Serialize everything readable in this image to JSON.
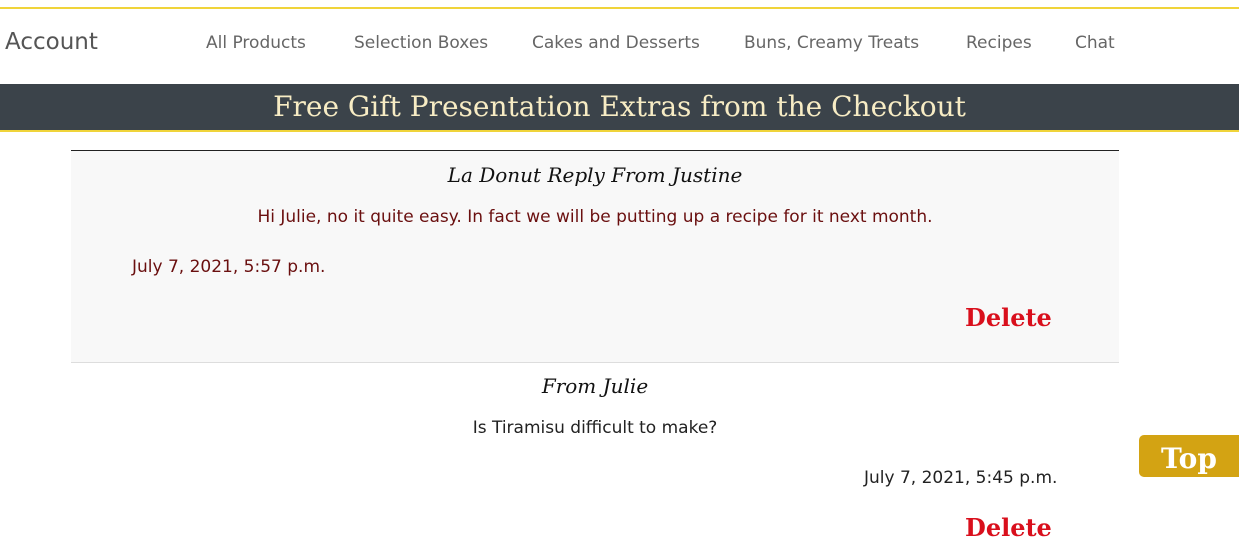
{
  "nav": {
    "account": "Account",
    "links": [
      "All Products",
      "Selection Boxes",
      "Cakes and Desserts",
      "Buns, Creamy Treats",
      "Recipes",
      "Chat"
    ]
  },
  "banner": {
    "text": "Free Gift Presentation Extras from the Checkout"
  },
  "messages": [
    {
      "heading": "La Donut Reply From Justine",
      "body": "Hi Julie, no it quite easy. In fact we will be putting up a recipe for it next month.",
      "date": "July 7, 2021, 5:57 p.m.",
      "delete_label": "Delete"
    },
    {
      "heading": "From Julie",
      "body": "Is Tiramisu difficult to make?",
      "date": "July 7, 2021, 5:45 p.m.",
      "delete_label": "Delete"
    }
  ],
  "top_button": {
    "label": "Top"
  },
  "colors": {
    "accent": "#f0d43a",
    "banner_bg": "#3b434a",
    "banner_text": "#f7ecc4",
    "reply_text": "#6a0f0f",
    "delete": "#d90f1c",
    "top_button": "#d3a313"
  }
}
